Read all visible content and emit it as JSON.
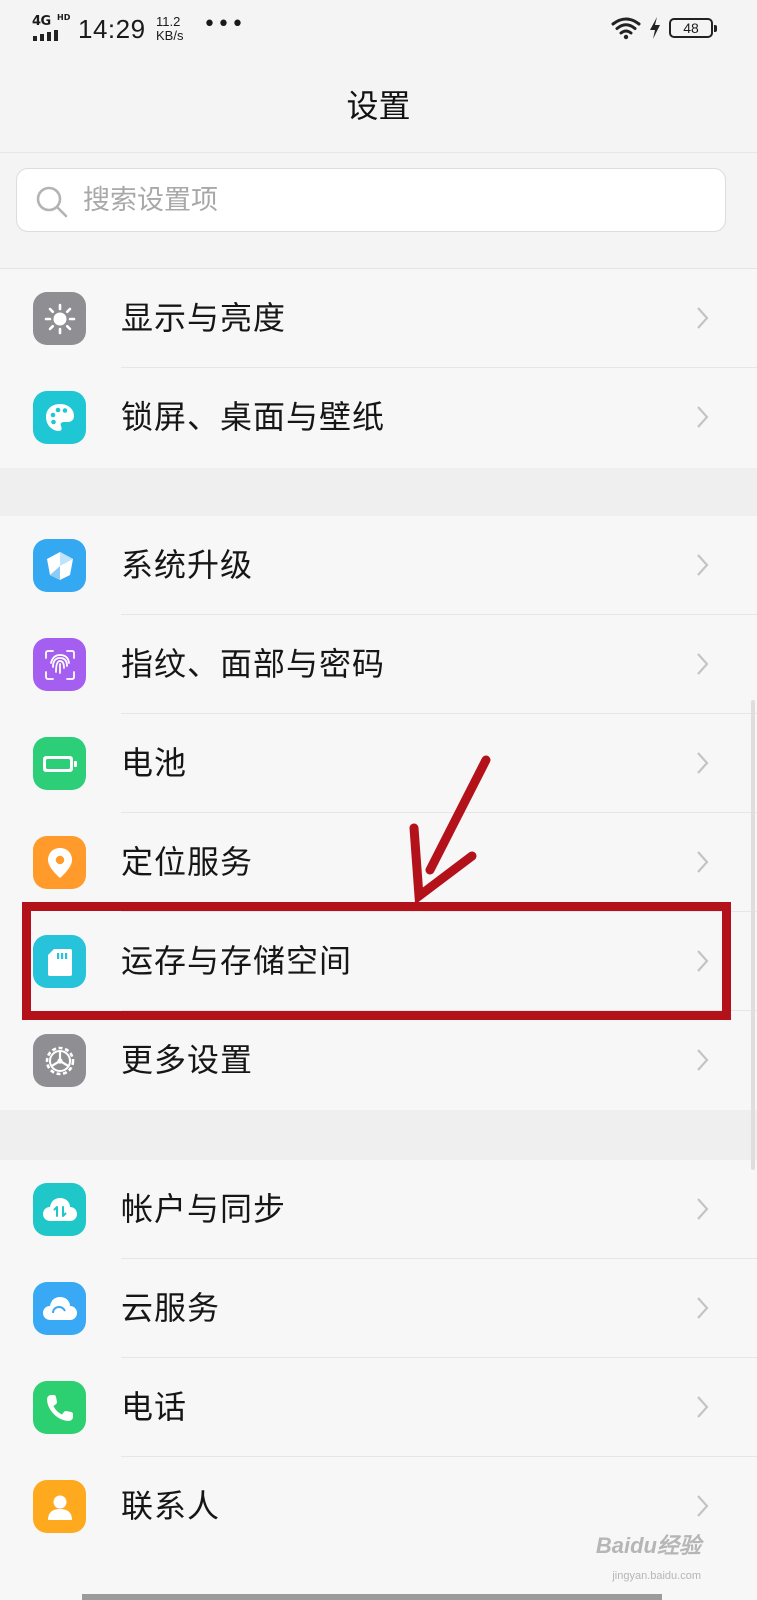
{
  "status_bar": {
    "network": "4G",
    "network_hd": "HD",
    "time": "14:29",
    "speed_value": "11.2",
    "speed_unit": "KB/s",
    "more_dots": "•••",
    "battery": "48"
  },
  "header": {
    "title": "设置"
  },
  "search": {
    "placeholder": "搜索设置项"
  },
  "groups": [
    {
      "items": [
        {
          "label": "显示与亮度",
          "icon": "brightness-icon",
          "color": "#8e8e93"
        },
        {
          "label": "锁屏、桌面与壁纸",
          "icon": "palette-icon",
          "color": "#1fc6d4"
        }
      ]
    },
    {
      "items": [
        {
          "label": "系统升级",
          "icon": "system-upgrade-icon",
          "color": "#35a8f2"
        },
        {
          "label": "指纹、面部与密码",
          "icon": "fingerprint-icon",
          "color": "#a55ff0"
        },
        {
          "label": "电池",
          "icon": "battery-icon",
          "color": "#2ccf78"
        },
        {
          "label": "定位服务",
          "icon": "location-icon",
          "color": "#ff9a2b"
        },
        {
          "label": "运存与存储空间",
          "icon": "storage-icon",
          "color": "#26c3da"
        },
        {
          "label": "更多设置",
          "icon": "gear-icon",
          "color": "#8e8e93"
        }
      ]
    },
    {
      "items": [
        {
          "label": "帐户与同步",
          "icon": "account-sync-icon",
          "color": "#20c7c9"
        },
        {
          "label": "云服务",
          "icon": "cloud-icon",
          "color": "#39a9f5"
        },
        {
          "label": "电话",
          "icon": "phone-icon",
          "color": "#2dd070"
        },
        {
          "label": "联系人",
          "icon": "contacts-icon",
          "color": "#ffa91e"
        }
      ]
    }
  ],
  "annotation": {
    "highlight_color": "#b3121b"
  },
  "watermark": {
    "text": "Baidu经验",
    "sub": "jingyan.baidu.com"
  }
}
